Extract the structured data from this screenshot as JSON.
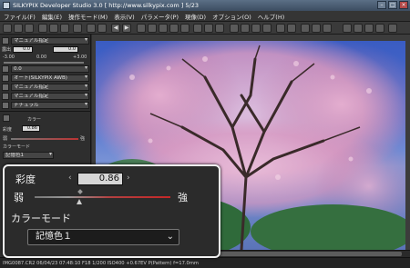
{
  "window": {
    "title": "SILKYPIX Developer Studio 3.0 [ http://www.silkypix.com ]   5/23"
  },
  "menu": {
    "items": [
      "ファイル(F)",
      "編集(E)",
      "操作モード(M)",
      "表示(V)",
      "パラメータ(P)",
      "現像(D)",
      "オプション(O)",
      "ヘルプ(H)"
    ]
  },
  "panel": {
    "rows": [
      {
        "label": "マニュアル指定"
      },
      {
        "label": "マニュアル指定"
      },
      {
        "label": "0.0"
      },
      {
        "label": "オート(SILKYPIX AWB)"
      },
      {
        "label": "マニュアル指定"
      },
      {
        "label": "マニュアル指定"
      },
      {
        "label": "ナチュラル"
      }
    ],
    "exposure_min": "-3.00",
    "exposure_mid": "0.00",
    "exposure_max": "+3.00",
    "field_left": "0.0",
    "field_right": "0.0",
    "color_tab": "カラー",
    "saturation_label": "彩度",
    "saturation_value": "0.86",
    "weak": "弱",
    "strong": "強",
    "color_mode_label": "カラーモード",
    "color_mode_value": "記憶色1"
  },
  "zoom": {
    "saturation_label": "彩度",
    "saturation_value": "0.86",
    "weak_label": "弱",
    "strong_label": "強",
    "color_mode_label": "カラーモード",
    "color_mode_value": "記憶色１",
    "saturation_level": 0.33
  },
  "statusbar": {
    "text": "IMG0087.CR2  06/04/23 07:48:10  F18  1/200  ISO400 +0.67EV  P(Pattern)  f=17.0mm"
  },
  "colors": {
    "accent_red": "#c62828",
    "panel_bg": "#2e2e2e"
  }
}
